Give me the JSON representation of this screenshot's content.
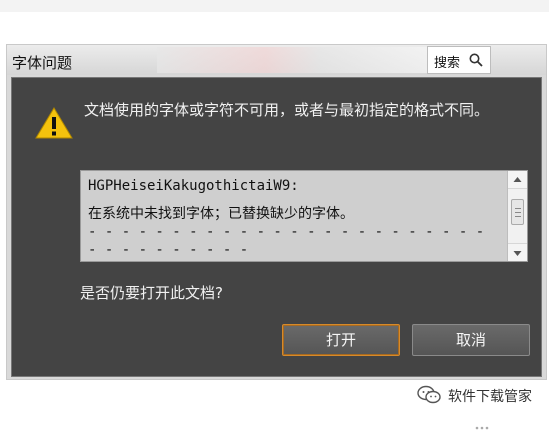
{
  "dialog": {
    "title": "字体问题",
    "search_label": "搜索",
    "message": "文档使用的字体或字符不可用，或者与最初指定的格式不同。",
    "details": [
      "HGPHeiseiKakugothictaiW9:",
      "在系统中未找到字体；已替换缺少的字体。",
      "- - - - - - - - - - - - - - - - - - - - - - - -",
      "- - - - - - - - - -"
    ],
    "question": "是否仍要打开此文档?",
    "buttons": {
      "open": "打开",
      "cancel": "取消"
    }
  },
  "watermark": {
    "text": "软件下载管家"
  },
  "colors": {
    "dialog_bg": "#444444",
    "accent": "#d78a2a",
    "warning": "#f4c20d"
  }
}
